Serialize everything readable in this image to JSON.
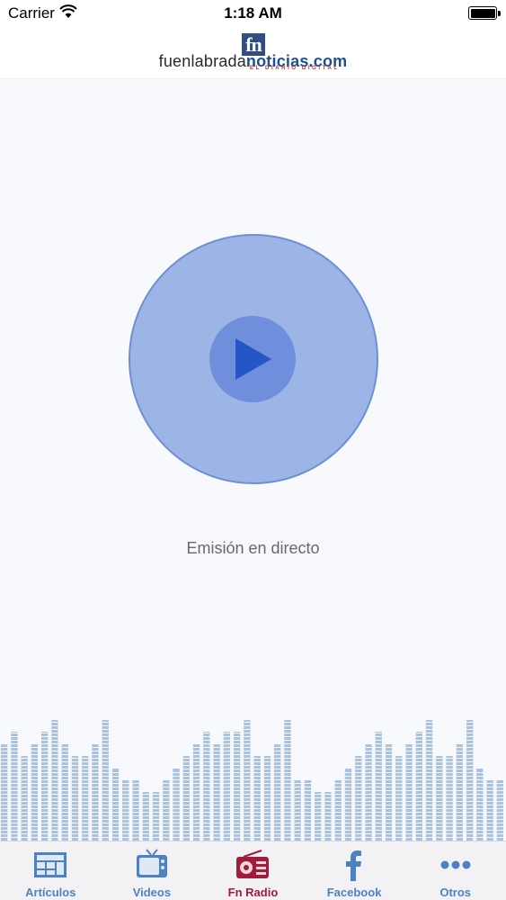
{
  "status_bar": {
    "carrier": "Carrier",
    "time": "1:18 AM"
  },
  "header": {
    "logo_mark": "fn",
    "logo_text_a": "fuenlabrada",
    "logo_text_b": "noticias",
    "logo_text_c": ".com",
    "tagline": "EL DIARIO DIGITAL"
  },
  "player": {
    "status_label": "Emisión en directo"
  },
  "tabs": [
    {
      "label": "Artículos",
      "icon": "newspaper-icon",
      "active": false
    },
    {
      "label": "Videos",
      "icon": "tv-icon",
      "active": false
    },
    {
      "label": "Fn Radio",
      "icon": "radio-icon",
      "active": true
    },
    {
      "label": "Facebook",
      "icon": "facebook-icon",
      "active": false
    },
    {
      "label": "Otros",
      "icon": "more-icon",
      "active": false
    }
  ],
  "equalizer": {
    "levels": [
      8,
      9,
      7,
      8,
      9,
      10,
      8,
      7,
      7,
      8,
      10,
      6,
      5,
      5,
      4,
      4,
      5,
      6,
      7,
      8,
      9,
      8,
      9,
      9,
      10,
      7,
      7,
      8,
      10,
      5,
      5,
      4,
      4,
      5,
      6,
      7,
      8,
      9,
      8,
      7,
      8,
      9,
      10,
      7,
      7,
      8,
      10,
      6,
      5,
      5
    ],
    "max_level": 10
  },
  "colors": {
    "accent": "#4d82c2",
    "active_tab": "#a01c3c",
    "play_fill": "#9db4e6",
    "play_triangle": "#2456c6",
    "bar": "#a9c1e4"
  }
}
